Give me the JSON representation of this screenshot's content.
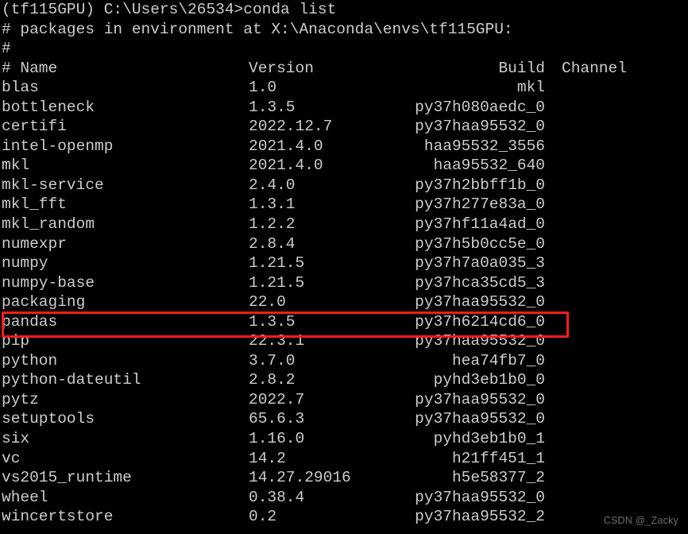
{
  "terminal": {
    "prompt_line": "(tf115GPU) C:\\Users\\26534>conda list",
    "comment_env": "# packages in environment at X:\\Anaconda\\envs\\tf115GPU:",
    "comment_blank": "#",
    "colors": {
      "background": "#000000",
      "text": "#cccccc",
      "highlight_border": "#fc1c1c",
      "watermark": "#6d6d6d"
    }
  },
  "table": {
    "headers": {
      "name": "# Name",
      "version": "Version",
      "build": "Build",
      "channel": "Channel"
    },
    "rows": [
      {
        "name": "blas",
        "version": "1.0",
        "build": "mkl",
        "channel": ""
      },
      {
        "name": "bottleneck",
        "version": "1.3.5",
        "build": "py37h080aedc_0",
        "channel": ""
      },
      {
        "name": "certifi",
        "version": "2022.12.7",
        "build": "py37haa95532_0",
        "channel": ""
      },
      {
        "name": "intel-openmp",
        "version": "2021.4.0",
        "build": "haa95532_3556",
        "channel": ""
      },
      {
        "name": "mkl",
        "version": "2021.4.0",
        "build": "haa95532_640",
        "channel": ""
      },
      {
        "name": "mkl-service",
        "version": "2.4.0",
        "build": "py37h2bbff1b_0",
        "channel": ""
      },
      {
        "name": "mkl_fft",
        "version": "1.3.1",
        "build": "py37h277e83a_0",
        "channel": ""
      },
      {
        "name": "mkl_random",
        "version": "1.2.2",
        "build": "py37hf11a4ad_0",
        "channel": ""
      },
      {
        "name": "numexpr",
        "version": "2.8.4",
        "build": "py37h5b0cc5e_0",
        "channel": ""
      },
      {
        "name": "numpy",
        "version": "1.21.5",
        "build": "py37h7a0a035_3",
        "channel": ""
      },
      {
        "name": "numpy-base",
        "version": "1.21.5",
        "build": "py37hca35cd5_3",
        "channel": ""
      },
      {
        "name": "packaging",
        "version": "22.0",
        "build": "py37haa95532_0",
        "channel": ""
      },
      {
        "name": "pandas",
        "version": "1.3.5",
        "build": "py37h6214cd6_0",
        "channel": ""
      },
      {
        "name": "pip",
        "version": "22.3.1",
        "build": "py37haa95532_0",
        "channel": ""
      },
      {
        "name": "python",
        "version": "3.7.0",
        "build": "hea74fb7_0",
        "channel": ""
      },
      {
        "name": "python-dateutil",
        "version": "2.8.2",
        "build": "pyhd3eb1b0_0",
        "channel": ""
      },
      {
        "name": "pytz",
        "version": "2022.7",
        "build": "py37haa95532_0",
        "channel": ""
      },
      {
        "name": "setuptools",
        "version": "65.6.3",
        "build": "py37haa95532_0",
        "channel": ""
      },
      {
        "name": "six",
        "version": "1.16.0",
        "build": "pyhd3eb1b0_1",
        "channel": ""
      },
      {
        "name": "vc",
        "version": "14.2",
        "build": "h21ff451_1",
        "channel": ""
      },
      {
        "name": "vs2015_runtime",
        "version": "14.27.29016",
        "build": "h5e58377_2",
        "channel": ""
      },
      {
        "name": "wheel",
        "version": "0.38.4",
        "build": "py37haa95532_0",
        "channel": ""
      },
      {
        "name": "wincertstore",
        "version": "0.2",
        "build": "py37haa95532_2",
        "channel": ""
      }
    ],
    "highlighted_row_index": 12
  },
  "watermark": {
    "text": "CSDN @_Zacky"
  }
}
